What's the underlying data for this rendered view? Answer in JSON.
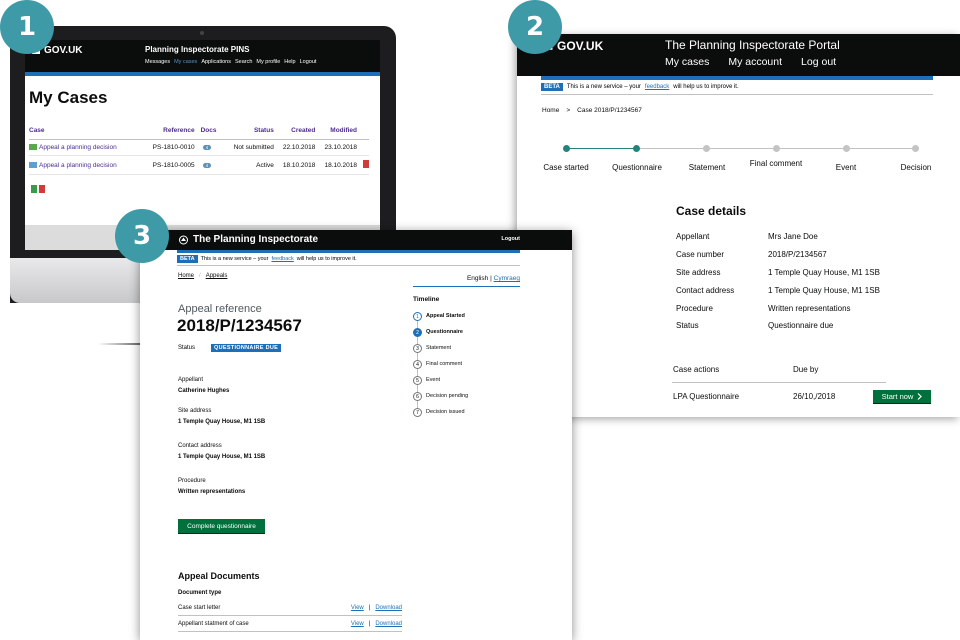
{
  "steps": [
    "1",
    "2",
    "3"
  ],
  "panel1": {
    "logo": "GOV.UK",
    "title": "Planning Inspectorate PINS",
    "nav": [
      "Messages",
      "My cases",
      "Applications",
      "Search",
      "My profile",
      "Help",
      "Logout"
    ],
    "heading": "My Cases",
    "columns": [
      "Case",
      "Reference",
      "Docs",
      "Status",
      "Created",
      "Modified"
    ],
    "rows": [
      {
        "case": "Appeal a planning decision",
        "reference": "PS-1810-0010",
        "docs": "4",
        "status": "Not submitted",
        "created": "22.10.2018",
        "modified": "23.10.2018"
      },
      {
        "case": "Appeal a planning decision",
        "reference": "PS-1810-0005",
        "docs": "4",
        "status": "Active",
        "created": "18.10.2018",
        "modified": "18.10.2018"
      }
    ]
  },
  "panel2": {
    "logo": "GOV.UK",
    "title": "The Planning Inspectorate Portal",
    "nav": [
      "My cases",
      "My account",
      "Log out"
    ],
    "beta_tag": "BETA",
    "beta_pre": "This is a new service – your",
    "beta_link": "feedback",
    "beta_post": "will help us to improve it.",
    "crumb": [
      "Home",
      ">",
      "Case 2018/P/1234567"
    ],
    "progress": [
      "Case started",
      "Questionnaire",
      "Statement",
      "Final comment",
      "Event",
      "Decision"
    ],
    "heading": "Case details",
    "details": [
      {
        "label": "Appellant",
        "value": "Mrs Jane Doe"
      },
      {
        "label": "Case number",
        "value": "2018/P/2134567"
      },
      {
        "label": "Site address",
        "value": "1 Temple Quay House, M1 1SB"
      },
      {
        "label": "Contact address",
        "value": "1 Temple Quay House, M1 1SB"
      },
      {
        "label": "Procedure",
        "value": "Written representations"
      },
      {
        "label": "Status",
        "value": "Questionnaire due"
      }
    ],
    "actions_header": "Case actions",
    "due_header": "Due by",
    "action": "LPA Questionnaire",
    "due": "26/10,/2018",
    "button": "Start now"
  },
  "panel3": {
    "title": "The Planning Inspectorate",
    "logout": "Logout",
    "beta_tag": "BETA",
    "beta_pre": "This is a new service – your",
    "beta_link": "feedback",
    "beta_post": "will help us to improve it.",
    "crumb": [
      "Home",
      "/",
      "Appeals"
    ],
    "lang_en": "English",
    "lang_sep": "|",
    "lang_cy": "Cymraeg",
    "caption": "Appeal reference",
    "reference": "2018/P/1234567",
    "status_label": "Status",
    "status_badge": "QUESTIONNAIRE DUE",
    "appellant_label": "Appellant",
    "appellant": "Catherine Hughes",
    "site_label": "Site address",
    "site": "1 Temple Quay House, M1 1SB",
    "contact_label": "Contact address",
    "contact": "1 Temple Quay House, M1 1SB",
    "procedure_label": "Procedure",
    "procedure": "Written representations",
    "button": "Complete questionnaire",
    "docs_heading": "Appeal Documents",
    "doc_type": "Document type",
    "docs": [
      {
        "name": "Case start letter",
        "view": "View",
        "sep": "|",
        "download": "Download"
      },
      {
        "name": "Appellant statment of case",
        "view": "View",
        "sep": "|",
        "download": "Download"
      }
    ],
    "timeline_heading": "Timeline",
    "timeline": [
      {
        "n": "1",
        "label": "Appeal Started"
      },
      {
        "n": "2",
        "label": "Questionnaire"
      },
      {
        "n": "3",
        "label": "Statement"
      },
      {
        "n": "4",
        "label": "Final comment"
      },
      {
        "n": "5",
        "label": "Event"
      },
      {
        "n": "6",
        "label": "Decision pending"
      },
      {
        "n": "7",
        "label": "Decision issued"
      }
    ]
  },
  "colors": {
    "teal": "#3f9aa8",
    "govuk_blue": "#1d70b8",
    "green": "#00703c",
    "black": "#0b0c0c",
    "purple": "#4c2c92"
  }
}
